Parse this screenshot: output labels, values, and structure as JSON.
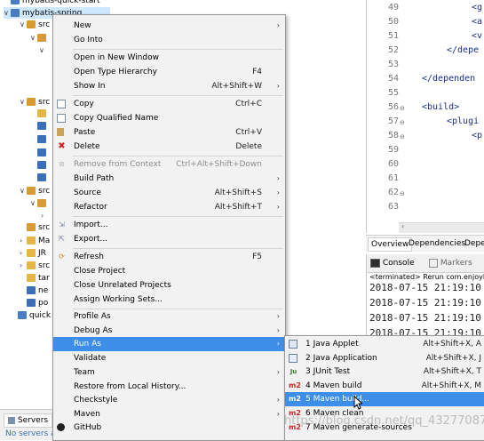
{
  "explorer": {
    "rows": [
      {
        "label": "mybatis-quick-start"
      },
      {
        "label": "mybatis-spring"
      },
      {
        "label": "src"
      },
      {
        "label": "src"
      },
      {
        "label": "src"
      },
      {
        "label": "src"
      },
      {
        "label": "Ma"
      },
      {
        "label": "JR"
      },
      {
        "label": "src"
      },
      {
        "label": "tar"
      },
      {
        "label": "ne"
      },
      {
        "label": "po"
      },
      {
        "label": "quick"
      }
    ]
  },
  "editor": {
    "lines": [
      {
        "num": "49",
        "code": "<g"
      },
      {
        "num": "50",
        "code": "<a"
      },
      {
        "num": "51",
        "code": "<v"
      },
      {
        "num": "52",
        "code": "</depe"
      },
      {
        "num": "53",
        "code": ""
      },
      {
        "num": "54",
        "code": "</dependen"
      },
      {
        "num": "55",
        "code": ""
      },
      {
        "num": "56",
        "code": "<build>"
      },
      {
        "num": "57",
        "code": "<plugi"
      },
      {
        "num": "58",
        "code": "<p"
      },
      {
        "num": "59",
        "code": ""
      },
      {
        "num": "60",
        "code": ""
      },
      {
        "num": "61",
        "code": ""
      },
      {
        "num": "62",
        "code": ""
      },
      {
        "num": "63",
        "code": ""
      }
    ],
    "tabs": [
      "Overview",
      "Dependencies",
      "Depe"
    ]
  },
  "console": {
    "tab_console": "Console",
    "tab_markers": "Markers",
    "terminated": "<terminated> Rerun com.enjoyl",
    "lines": [
      "2018-07-15 21:19:10",
      "2018-07-15 21:19:10",
      "2018-07-15 21:19:10",
      "2018-07-15 21:19:10"
    ]
  },
  "servers": {
    "tab": "Servers",
    "message": "No servers a"
  },
  "context_menu": {
    "items": [
      {
        "label": "New",
        "accel": "",
        "submenu": true
      },
      {
        "label": "Go Into",
        "accel": ""
      },
      {
        "sep": true
      },
      {
        "label": "Open in New Window",
        "accel": ""
      },
      {
        "label": "Open Type Hierarchy",
        "accel": "F4"
      },
      {
        "label": "Show In",
        "accel": "Alt+Shift+W",
        "submenu": true
      },
      {
        "sep": true
      },
      {
        "label": "Copy",
        "accel": "Ctrl+C",
        "icon": "copy"
      },
      {
        "label": "Copy Qualified Name",
        "accel": "",
        "icon": "copy"
      },
      {
        "label": "Paste",
        "accel": "Ctrl+V",
        "icon": "paste"
      },
      {
        "label": "Delete",
        "accel": "Delete",
        "icon": "delete"
      },
      {
        "sep": true
      },
      {
        "label": "Remove from Context",
        "accel": "Ctrl+Alt+Shift+Down",
        "disabled": true,
        "icon": "remove"
      },
      {
        "label": "Build Path",
        "accel": "",
        "submenu": true
      },
      {
        "label": "Source",
        "accel": "Alt+Shift+S",
        "submenu": true
      },
      {
        "label": "Refactor",
        "accel": "Alt+Shift+T",
        "submenu": true
      },
      {
        "sep": true
      },
      {
        "label": "Import...",
        "accel": "",
        "icon": "import"
      },
      {
        "label": "Export...",
        "accel": "",
        "icon": "export"
      },
      {
        "sep": true
      },
      {
        "label": "Refresh",
        "accel": "F5",
        "icon": "refresh"
      },
      {
        "label": "Close Project",
        "accel": ""
      },
      {
        "label": "Close Unrelated Projects",
        "accel": ""
      },
      {
        "label": "Assign Working Sets...",
        "accel": ""
      },
      {
        "sep": true
      },
      {
        "label": "Profile As",
        "accel": "",
        "submenu": true
      },
      {
        "label": "Debug As",
        "accel": "",
        "submenu": true
      },
      {
        "label": "Run As",
        "accel": "",
        "submenu": true,
        "highlighted": true
      },
      {
        "label": "Validate",
        "accel": ""
      },
      {
        "label": "Team",
        "accel": "",
        "submenu": true
      },
      {
        "label": "Restore from Local History...",
        "accel": ""
      },
      {
        "label": "Checkstyle",
        "accel": "",
        "submenu": true
      },
      {
        "label": "Maven",
        "accel": "",
        "submenu": true
      },
      {
        "label": "GitHub",
        "accel": "",
        "icon": "github"
      }
    ]
  },
  "run_as_menu": {
    "items": [
      {
        "label": "1 Java Applet",
        "accel": "Alt+Shift+X, A",
        "icon": "applet"
      },
      {
        "label": "2 Java Application",
        "accel": "Alt+Shift+X, J",
        "icon": "java-app"
      },
      {
        "label": "3 JUnit Test",
        "accel": "Alt+Shift+X, T",
        "icon": "junit",
        "icon_text": "Ju"
      },
      {
        "label": "4 Maven build",
        "accel": "Alt+Shift+X, M",
        "icon": "maven",
        "icon_text": "m2"
      },
      {
        "label": "5 Maven build...",
        "accel": "",
        "icon": "maven",
        "icon_text": "m2",
        "highlighted": true
      },
      {
        "label": "6 Maven clean",
        "accel": "",
        "icon": "maven",
        "icon_text": "m2"
      },
      {
        "label": "7 Maven generate-sources",
        "accel": "",
        "icon": "maven",
        "icon_text": "m2"
      }
    ]
  },
  "watermark": "https://blog.csdn.net/qq_43277087",
  "colors": {
    "highlight": "#3d8ee8",
    "menu_bg": "#f2f2f2",
    "maven_red": "#c62828"
  }
}
